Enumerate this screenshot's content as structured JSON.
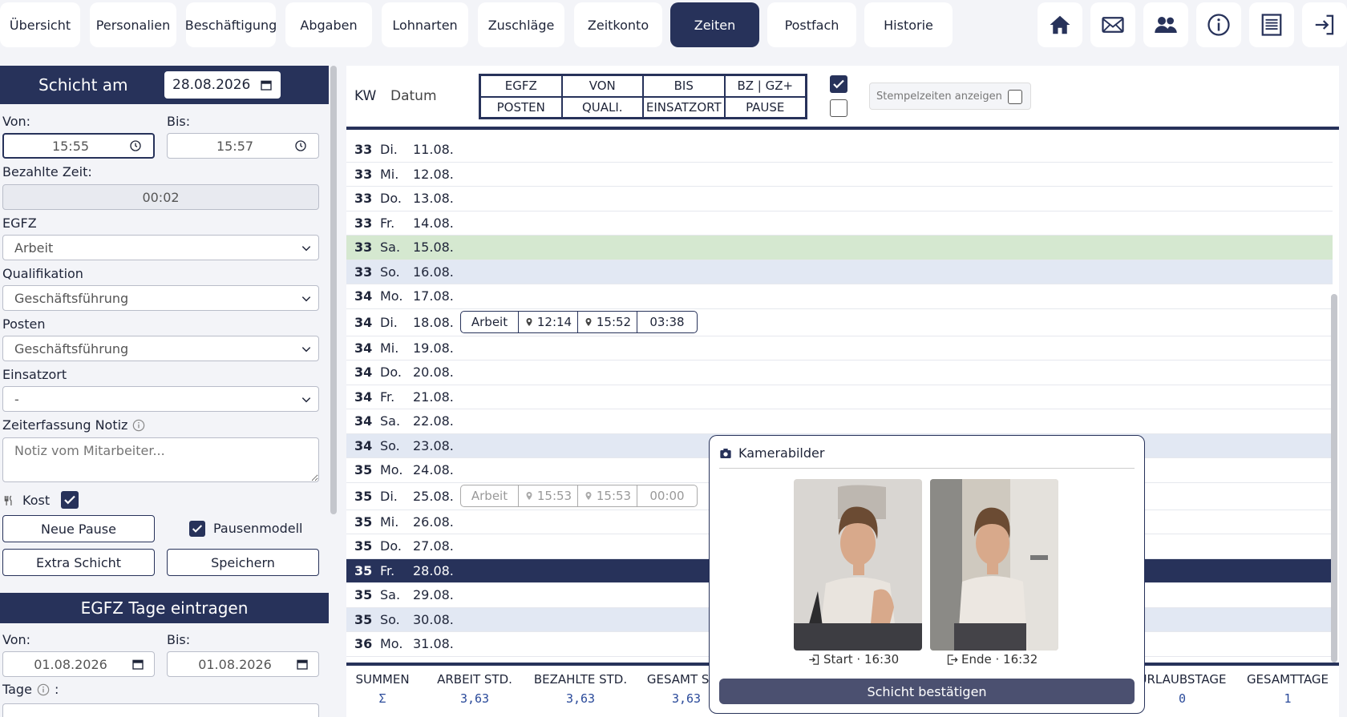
{
  "nav": {
    "tabs": [
      "Übersicht",
      "Personalien",
      "Beschäftigung",
      "Abgaben",
      "Lohnarten",
      "Zuschläge",
      "Zeitkonto",
      "Zeiten",
      "Postfach",
      "Historie"
    ],
    "active": "Zeiten",
    "icons": [
      "home-icon",
      "mail-icon",
      "users-icon",
      "info-icon",
      "list-icon",
      "logout-icon"
    ]
  },
  "shift_form": {
    "title": "Schicht am",
    "date": "28.08.2026",
    "von_label": "Von:",
    "von": "15:55",
    "bis_label": "Bis:",
    "bis": "15:57",
    "bezahlt_label": "Bezahlte Zeit:",
    "bezahlt": "00:02",
    "egfz_label": "EGFZ",
    "egfz": "Arbeit",
    "quali_label": "Qualifikation",
    "quali": "Geschäftsführung",
    "posten_label": "Posten",
    "posten": "Geschäftsführung",
    "einsatz_label": "Einsatzort",
    "einsatz": "-",
    "notiz_label": "Zeiterfassung Notiz",
    "notiz_placeholder": "Notiz vom Mitarbeiter...",
    "kost_label": "Kost",
    "kost_checked": true,
    "neue_pause": "Neue Pause",
    "pausenmodell": "Pausenmodell",
    "extra_schicht": "Extra Schicht",
    "speichern": "Speichern"
  },
  "egfz_tage": {
    "title": "EGFZ Tage eintragen",
    "von_label": "Von:",
    "von": "01.08.2026",
    "bis_label": "Bis:",
    "bis": "01.08.2026",
    "tage_label": "Tage",
    "tage_colon": ":"
  },
  "table": {
    "kw_label": "KW",
    "datum_label": "Datum",
    "header_grid": [
      "EGFZ",
      "VON",
      "BIS",
      "BZ | GZ+",
      "POSTEN",
      "QUALI.",
      "EINSATZORT",
      "PAUSE"
    ],
    "stempel_label": "Stempelzeiten anzeigen",
    "rows": [
      {
        "kw": "33",
        "wd": "Di.",
        "date": "11.08.",
        "style": ""
      },
      {
        "kw": "33",
        "wd": "Mi.",
        "date": "12.08.",
        "style": ""
      },
      {
        "kw": "33",
        "wd": "Do.",
        "date": "13.08.",
        "style": ""
      },
      {
        "kw": "33",
        "wd": "Fr.",
        "date": "14.08.",
        "style": ""
      },
      {
        "kw": "33",
        "wd": "Sa.",
        "date": "15.08.",
        "style": "green"
      },
      {
        "kw": "33",
        "wd": "So.",
        "date": "16.08.",
        "style": "blue"
      },
      {
        "kw": "34",
        "wd": "Mo.",
        "date": "17.08.",
        "style": ""
      },
      {
        "kw": "34",
        "wd": "Di.",
        "date": "18.08.",
        "style": "",
        "shift": {
          "type": "Arbeit",
          "von": "12:14",
          "bis": "15:52",
          "dur": "03:38",
          "faded": false
        }
      },
      {
        "kw": "34",
        "wd": "Mi.",
        "date": "19.08.",
        "style": ""
      },
      {
        "kw": "34",
        "wd": "Do.",
        "date": "20.08.",
        "style": ""
      },
      {
        "kw": "34",
        "wd": "Fr.",
        "date": "21.08.",
        "style": ""
      },
      {
        "kw": "34",
        "wd": "Sa.",
        "date": "22.08.",
        "style": ""
      },
      {
        "kw": "34",
        "wd": "So.",
        "date": "23.08.",
        "style": "blue"
      },
      {
        "kw": "35",
        "wd": "Mo.",
        "date": "24.08.",
        "style": ""
      },
      {
        "kw": "35",
        "wd": "Di.",
        "date": "25.08.",
        "style": "",
        "shift": {
          "type": "Arbeit",
          "von": "15:53",
          "bis": "15:53",
          "dur": "00:00",
          "faded": true
        }
      },
      {
        "kw": "35",
        "wd": "Mi.",
        "date": "26.08.",
        "style": ""
      },
      {
        "kw": "35",
        "wd": "Do.",
        "date": "27.08.",
        "style": ""
      },
      {
        "kw": "35",
        "wd": "Fr.",
        "date": "28.08.",
        "style": "sel"
      },
      {
        "kw": "35",
        "wd": "Sa.",
        "date": "29.08.",
        "style": ""
      },
      {
        "kw": "35",
        "wd": "So.",
        "date": "30.08.",
        "style": "blue"
      },
      {
        "kw": "36",
        "wd": "Mo.",
        "date": "31.08.",
        "style": ""
      }
    ]
  },
  "sums": {
    "summen": "SUMMEN",
    "sigma": "Σ",
    "arbeit_h": "ARBEIT STD.",
    "arbeit": "3,63",
    "bezahlt_h": "BEZAHLTE STD.",
    "bezahlt": "3,63",
    "gesamt_h": "GESAMT STD",
    "gesamt": "3,63",
    "urlaub_h": "URLAUBSTAGE",
    "urlaub": "0",
    "gtage_h": "GESAMTTAGE",
    "gtage": "1"
  },
  "modal": {
    "title": "Kamerabilder",
    "start": "Start · 16:30",
    "ende": "Ende · 16:32",
    "confirm": "Schicht bestätigen"
  }
}
